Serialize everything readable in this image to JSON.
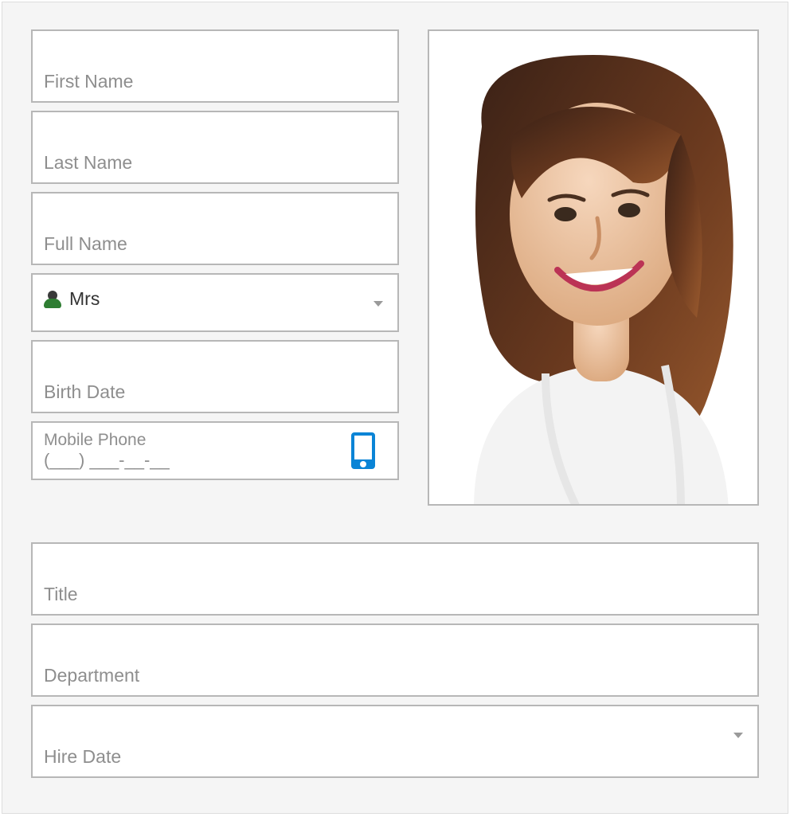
{
  "fields": {
    "first_name": {
      "label": "First Name",
      "value": ""
    },
    "last_name": {
      "label": "Last Name",
      "value": ""
    },
    "full_name": {
      "label": "Full Name",
      "value": ""
    },
    "prefix": {
      "selected": "Mrs",
      "icon": "person-female-icon"
    },
    "birth_date": {
      "label": "Birth Date",
      "value": ""
    },
    "mobile": {
      "label": "Mobile Phone",
      "mask": "(___) ___-__-__",
      "icon": "mobile-phone-icon"
    },
    "title": {
      "label": "Title",
      "value": ""
    },
    "department": {
      "label": "Department",
      "value": ""
    },
    "hire_date": {
      "label": "Hire Date",
      "value": ""
    }
  },
  "photo": {
    "description": "employee-photo"
  }
}
